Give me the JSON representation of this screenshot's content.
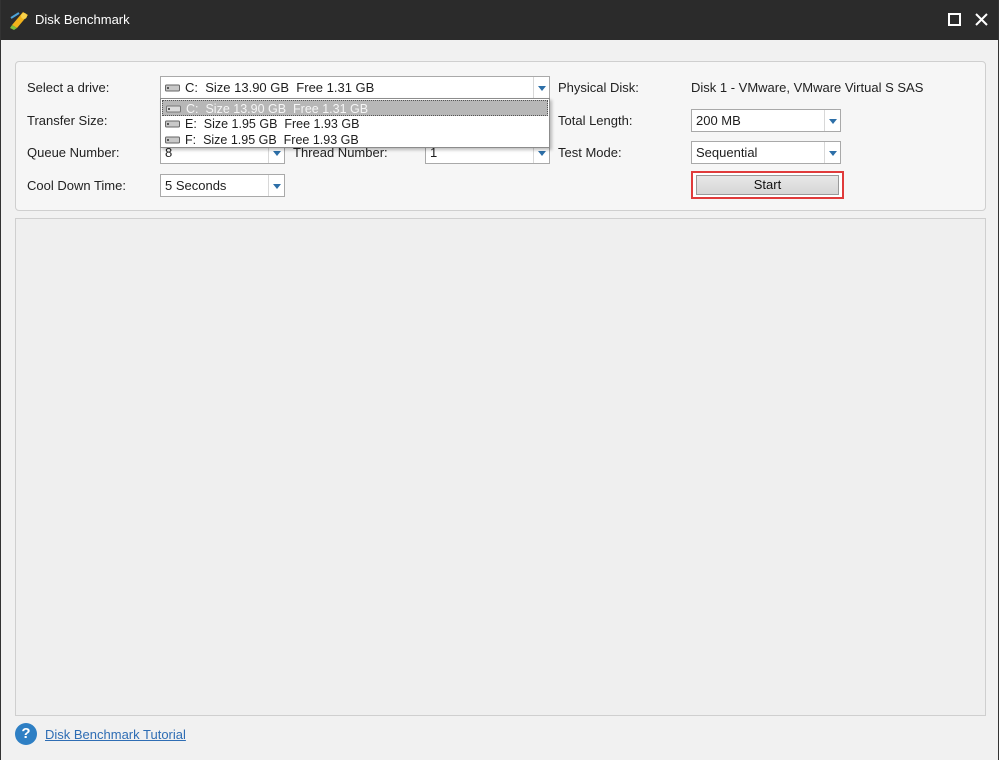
{
  "window": {
    "title": "Disk Benchmark",
    "maximize_icon": "maximize-icon",
    "close_icon": "close-icon"
  },
  "settings": {
    "select_drive_label": "Select a drive:",
    "selected_drive": {
      "letter": "C:",
      "size": "Size 13.90 GB",
      "free": "Free 1.31 GB"
    },
    "drive_options": [
      {
        "letter": "C:",
        "size": "Size 13.90 GB",
        "free": "Free 1.31 GB"
      },
      {
        "letter": "E:",
        "size": "Size 1.95 GB",
        "free": "Free 1.93 GB"
      },
      {
        "letter": "F:",
        "size": "Size 1.95 GB",
        "free": "Free 1.93 GB"
      }
    ],
    "physical_disk_label": "Physical Disk:",
    "physical_disk_value": "Disk 1 - VMware, VMware Virtual S SAS",
    "transfer_size_label": "Transfer Size:",
    "total_length_label": "Total Length:",
    "total_length_value": "200 MB",
    "queue_number_label": "Queue Number:",
    "queue_number_value": "8",
    "thread_number_label": "Thread Number:",
    "thread_number_value": "1",
    "test_mode_label": "Test Mode:",
    "test_mode_value": "Sequential",
    "cool_down_label": "Cool Down Time:",
    "cool_down_value": "5 Seconds",
    "start_label": "Start"
  },
  "footer": {
    "help_icon": "help-icon",
    "help_glyph": "?",
    "tutorial_link": "Disk Benchmark Tutorial"
  },
  "colors": {
    "titlebar": "#2b2b2b",
    "highlight": "#e03b3b",
    "link": "#2e6db4",
    "arrow": "#2d6fa8"
  }
}
